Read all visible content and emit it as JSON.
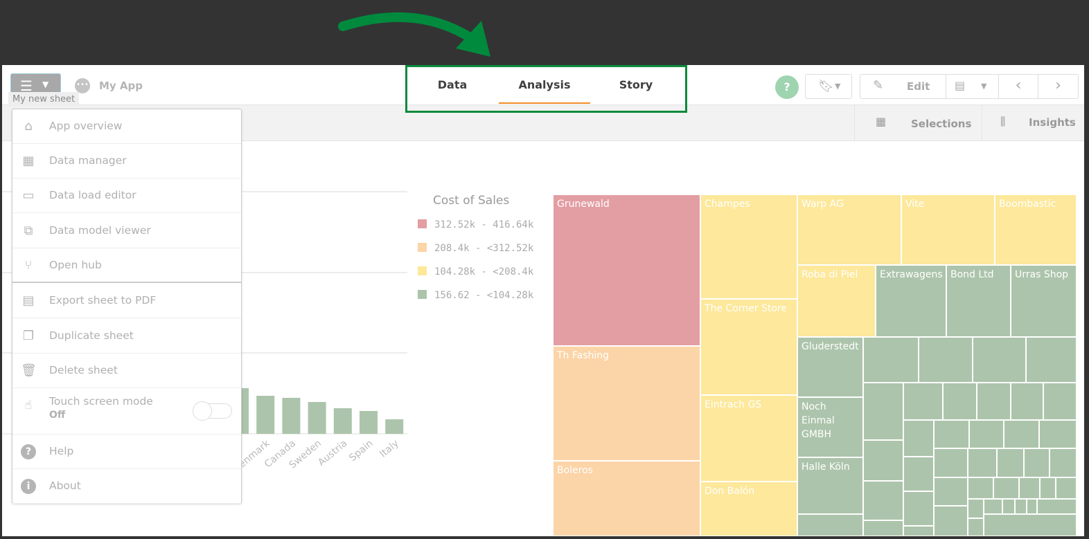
{
  "header": {
    "app_name": "My App",
    "sheet_tooltip": "My new sheet",
    "tabs": [
      {
        "label": "Data"
      },
      {
        "label": "Analysis",
        "active": true
      },
      {
        "label": "Story"
      }
    ],
    "help": "?",
    "edit": "Edit"
  },
  "toolbar": {
    "selections": "Selections",
    "insights": "Insights"
  },
  "menu": {
    "items": [
      {
        "label": "App overview",
        "icon": "home-icon"
      },
      {
        "label": "Data manager",
        "icon": "data-manager-icon"
      },
      {
        "label": "Data load editor",
        "icon": "data-load-editor-icon"
      },
      {
        "label": "Data model viewer",
        "icon": "data-model-icon"
      },
      {
        "label": "Open hub",
        "icon": "hub-icon"
      },
      {
        "label": "Export sheet to PDF",
        "icon": "export-pdf-icon"
      },
      {
        "label": "Duplicate sheet",
        "icon": "duplicate-icon"
      },
      {
        "label": "Delete sheet",
        "icon": "trash-icon"
      },
      {
        "label": "Touch screen mode",
        "sub": "Off",
        "icon": "touch-icon"
      },
      {
        "label": "Help",
        "icon": "help-icon"
      },
      {
        "label": "About",
        "icon": "info-icon"
      }
    ]
  },
  "colors": {
    "accent": "#f28c28",
    "annotation": "#008a3e",
    "red": "#e39ea3",
    "orange": "#fbd4a7",
    "yellow": "#fde89b",
    "green": "#acc4ab"
  },
  "chart_data": [
    {
      "type": "bar",
      "categories": [
        "",
        "Denmark",
        "Canada",
        "Sweden",
        "Austria",
        "Spain",
        "Italy"
      ],
      "values": [
        66,
        55,
        52,
        46,
        37,
        33,
        21
      ],
      "color": "#acc4ab"
    },
    {
      "type": "treemap",
      "legend": {
        "title": "Cost of Sales",
        "items": [
          {
            "label": "312.52k - 416.64k",
            "color": "#e39ea3"
          },
          {
            "label": "208.4k - <312.52k",
            "color": "#fbd4a7"
          },
          {
            "label": "104.28k - <208.4k",
            "color": "#fde89b"
          },
          {
            "label": "156.62 - <104.28k",
            "color": "#acc4ab"
          }
        ]
      },
      "tiles": [
        {
          "label": "Grunewald",
          "band": 0
        },
        {
          "label": "Th Fashing",
          "band": 1
        },
        {
          "label": "Boleros",
          "band": 1
        },
        {
          "label": "Champes",
          "band": 2
        },
        {
          "label": "The Corner Store",
          "band": 2
        },
        {
          "label": "Eintrach GS",
          "band": 2
        },
        {
          "label": "Don Balón",
          "band": 2
        },
        {
          "label": "Warp AG",
          "band": 2
        },
        {
          "label": "Vite",
          "band": 2
        },
        {
          "label": "Boombastic",
          "band": 2
        },
        {
          "label": "Roba di Piel",
          "band": 2
        },
        {
          "label": "Extrawagens",
          "band": 3
        },
        {
          "label": "Bond Ltd",
          "band": 3
        },
        {
          "label": "Urras Shop",
          "band": 3
        },
        {
          "label": "Gluderstedt",
          "band": 3
        },
        {
          "label": "Noch Einmal GMBH",
          "band": 3
        },
        {
          "label": "Halle Köln",
          "band": 3
        }
      ]
    }
  ]
}
